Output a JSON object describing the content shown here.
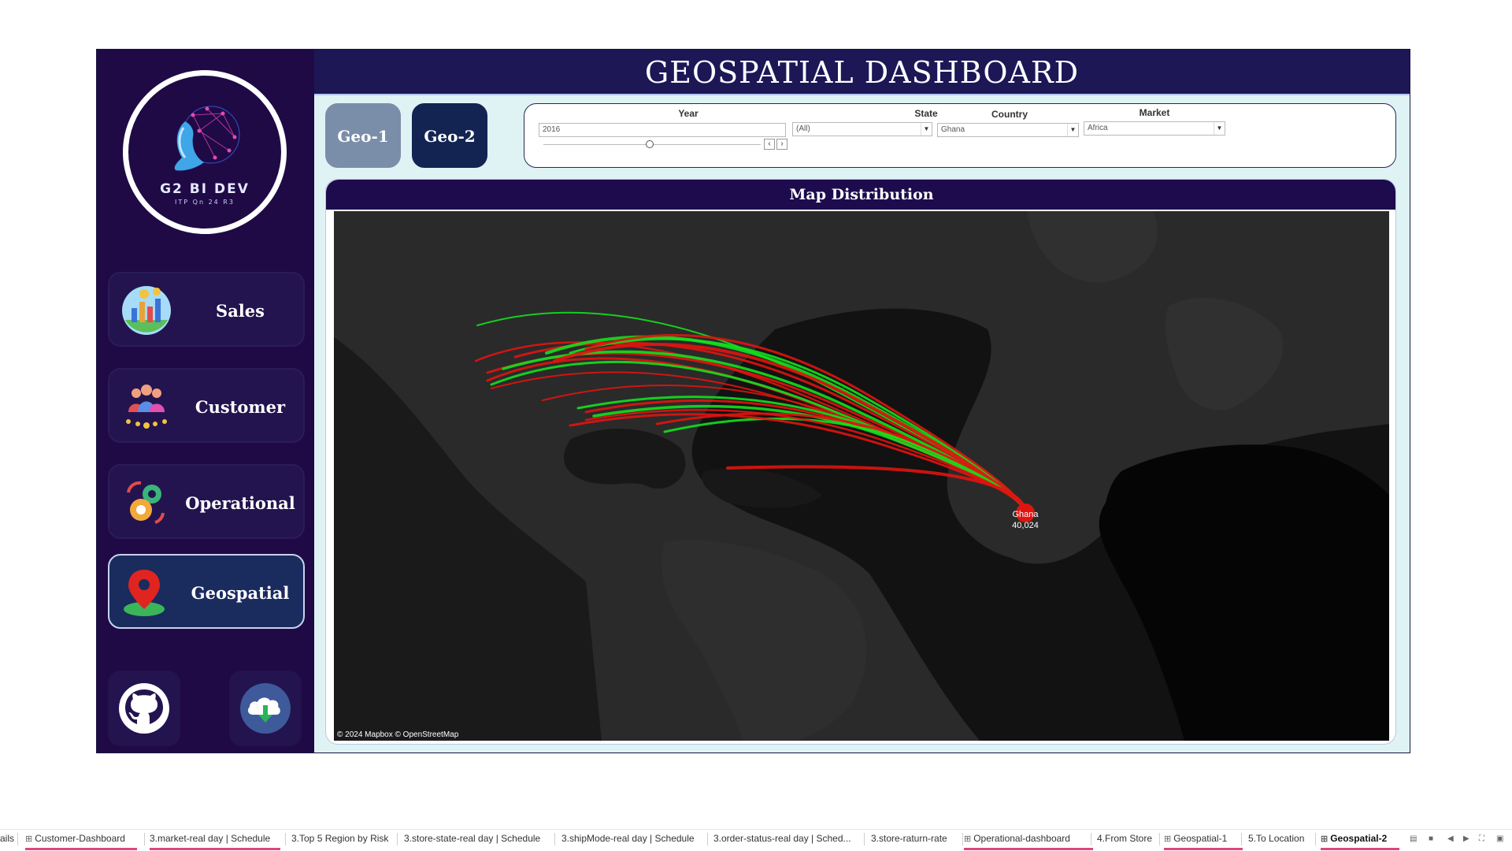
{
  "header": {
    "title": "GEOSPATIAL DASHBOARD"
  },
  "logo": {
    "brand": "G2 BI DEV",
    "subtitle": "ITP Qn 24 R3"
  },
  "nav": {
    "sales": "Sales",
    "customer": "Customer",
    "operational": "Operational",
    "geospatial": "Geospatial"
  },
  "geo_buttons": {
    "geo1": "Geo-1",
    "geo2": "Geo-2"
  },
  "filters": {
    "year": {
      "label": "Year",
      "value": "2016"
    },
    "state": {
      "label": "State",
      "value": "(All)"
    },
    "country": {
      "label": "Country",
      "value": "Ghana"
    },
    "market": {
      "label": "Market",
      "value": "Africa"
    }
  },
  "map": {
    "title": "Map Distribution",
    "marker_label": "Ghana",
    "marker_value": "40,024",
    "attribution": "© 2024 Mapbox © OpenStreetMap",
    "colors": {
      "background": "#2a2a2a",
      "ocean": "#111111",
      "green": "#14e01e",
      "red": "#e0140f"
    }
  },
  "tabs": [
    {
      "label": "ails",
      "icon": "none"
    },
    {
      "label": "Customer-Dashboard",
      "icon": "dashboard-icon"
    },
    {
      "label": "3.market-real day | Schedule",
      "icon": "none"
    },
    {
      "label": "3.Top 5 Region by Risk",
      "icon": "none"
    },
    {
      "label": "3.store-state-real day | Schedule",
      "icon": "none"
    },
    {
      "label": "3.shipMode-real day | Schedule",
      "icon": "none"
    },
    {
      "label": "3.order-status-real day | Sched...",
      "icon": "none"
    },
    {
      "label": "3.store-raturn-rate",
      "icon": "none"
    },
    {
      "label": "Operational-dashboard",
      "icon": "dashboard-icon"
    },
    {
      "label": "4.From Store",
      "icon": "none"
    },
    {
      "label": "Geospatial-1",
      "icon": "dashboard-icon"
    },
    {
      "label": "5.To Location",
      "icon": "none"
    },
    {
      "label": "Geospatial-2",
      "icon": "dashboard-icon"
    }
  ]
}
